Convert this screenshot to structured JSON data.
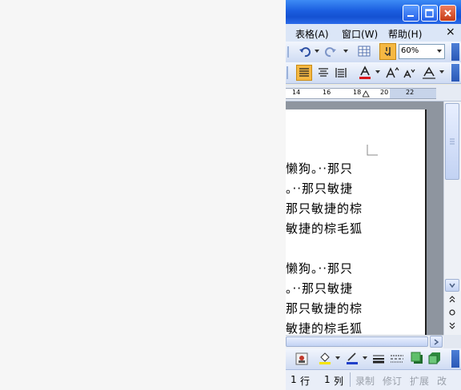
{
  "menu": {
    "table": "表格(A)",
    "window": "窗口(W)",
    "help": "帮助(H)",
    "close_glyph": "×"
  },
  "toolbar": {
    "zoom": "60%"
  },
  "ruler": {
    "ticks": [
      "14",
      "16",
      "18",
      "20",
      "22"
    ]
  },
  "document": {
    "lines": [
      "懒狗。··那只",
      "。··那只敏捷",
      "那只敏捷的棕",
      "敏捷的棕毛狐",
      "",
      "懒狗。··那只",
      "。··那只敏捷",
      "那只敏捷的棕",
      "敏捷的棕毛狐"
    ]
  },
  "status": {
    "line_num": "1",
    "line_unit": "行",
    "col_num": "1",
    "col_unit": "列",
    "rec": "录制",
    "trk": "修订",
    "ext": "扩展",
    "ovr": "改"
  },
  "colors": {
    "title": "#1b5ee0",
    "accent": "#f5b843",
    "font_color": "#d8161b"
  }
}
